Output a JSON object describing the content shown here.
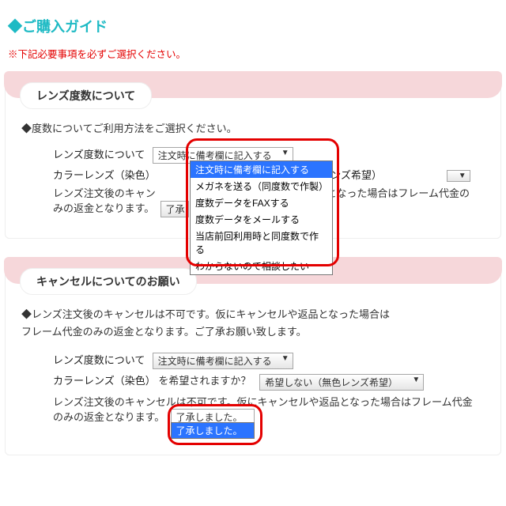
{
  "page": {
    "title": "◆ご購入ガイド",
    "notice": "※下記必要事項を必ずご選択ください。"
  },
  "section1": {
    "title": "レンズ度数について",
    "lead": "◆度数についてご利用方法をご選択ください。",
    "row1_label": "レンズ度数について",
    "row1_value": "注文時に備考欄に記入する",
    "dropdown_options": [
      "注文時に備考欄に記入する",
      "メガネを送る（同度数で作製）",
      "度数データをFAXする",
      "度数データをメールする",
      "当店前回利用時と同度数で作る",
      "わからないので相談したい"
    ],
    "row2_label": "カラーレンズ（染色）",
    "row2_trail": "（無色レンズ希望）",
    "row3_pre": "レンズ注文後のキャン",
    "row3_post": "返品となった場合はフレーム代金のみの返金となります。",
    "row3_small_value": "了承"
  },
  "section2": {
    "title": "キャンセルについてのお願い",
    "lead_l1": "◆レンズ注文後のキャンセルは不可です。仮にキャンセルや返品となった場合は",
    "lead_l2": "フレーム代金のみの返金となります。ご了承お願い致します。",
    "row1_label": "レンズ度数について",
    "row1_value": "注文時に備考欄に記入する",
    "row2_label": "カラーレンズ（染色）",
    "row2_mid": "を希望されますか？",
    "row2_value": "希望しない（無色レンズ希望）",
    "row3_text": "レンズ注文後のキャンセルは不可です。仮にキャンセルや返品となった場合はフレーム代金のみの返金となります。",
    "row3_value": "了承しました。",
    "dropdown2_options": [
      "了承しました。"
    ]
  },
  "ui": {
    "caret": "▼"
  }
}
